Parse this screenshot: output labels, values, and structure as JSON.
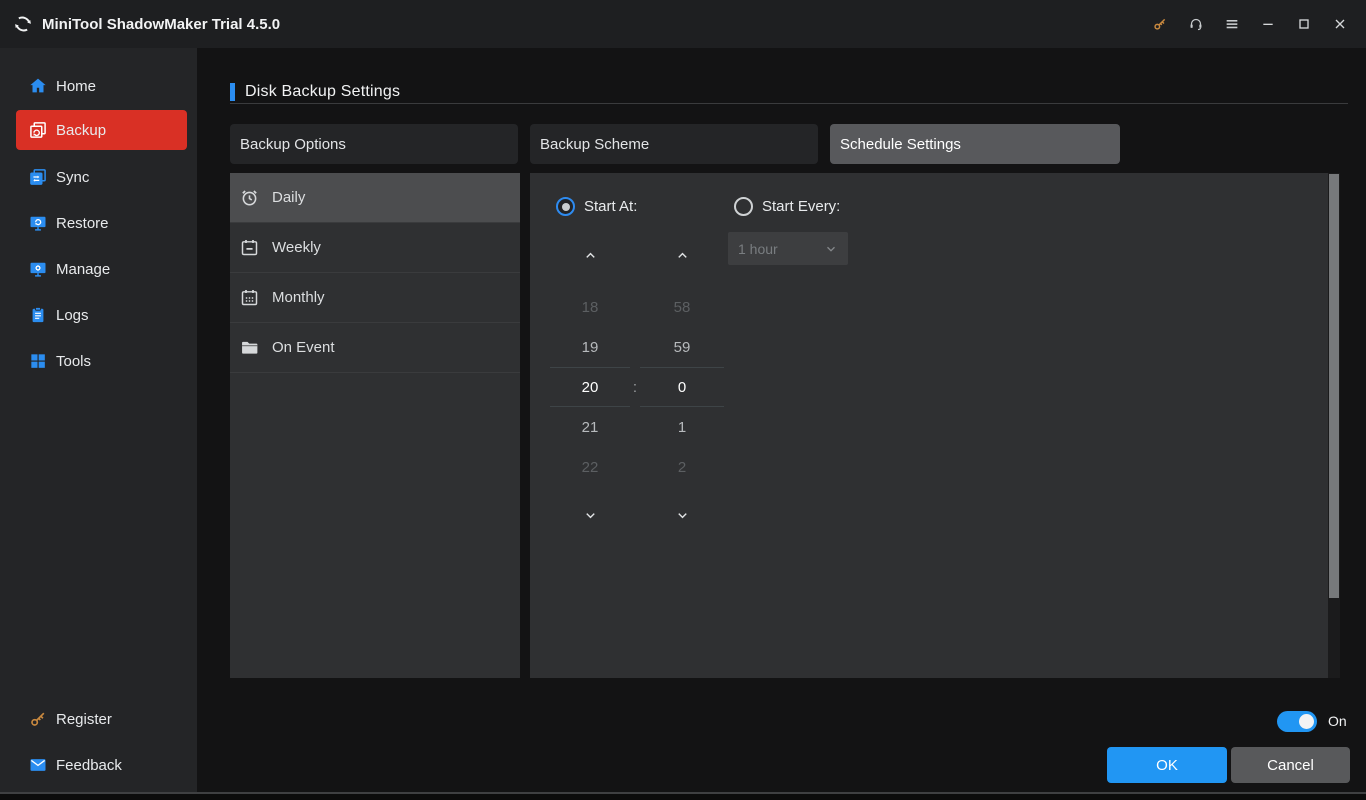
{
  "window": {
    "title": "MiniTool ShadowMaker Trial 4.5.0"
  },
  "sidebar": {
    "items": [
      {
        "label": "Home"
      },
      {
        "label": "Backup",
        "active": true
      },
      {
        "label": "Sync"
      },
      {
        "label": "Restore"
      },
      {
        "label": "Manage"
      },
      {
        "label": "Logs"
      },
      {
        "label": "Tools"
      }
    ],
    "footer_items": [
      {
        "label": "Register"
      },
      {
        "label": "Feedback"
      }
    ]
  },
  "header": {
    "title": "Disk Backup Settings"
  },
  "tabs": [
    {
      "label": "Backup Options"
    },
    {
      "label": "Backup Scheme"
    },
    {
      "label": "Schedule Settings",
      "active": true
    }
  ],
  "schedule_types": [
    {
      "label": "Daily",
      "selected": true
    },
    {
      "label": "Weekly"
    },
    {
      "label": "Monthly"
    },
    {
      "label": "On Event"
    }
  ],
  "schedule_panel": {
    "start_at_label": "Start At:",
    "start_every_label": "Start Every:",
    "interval_value": "1 hour",
    "interval_enabled": false,
    "time_picker": {
      "hours": [
        "18",
        "19",
        "20",
        "21",
        "22"
      ],
      "minutes": [
        "58",
        "59",
        "0",
        "1",
        "2"
      ],
      "selected_hour": "20",
      "selected_minute": "0",
      "separator": ":"
    }
  },
  "footer": {
    "toggle_state": "On",
    "ok_label": "OK",
    "cancel_label": "Cancel"
  },
  "colors": {
    "accent_blue": "#2b8df0",
    "backup_red": "#d93025",
    "key_orange": "#c9893f",
    "toggle_on": "#2196f3",
    "ok_button": "#2196f3",
    "panel_bg": "#2f3032",
    "titlebar_bg": "#1e1f21"
  }
}
